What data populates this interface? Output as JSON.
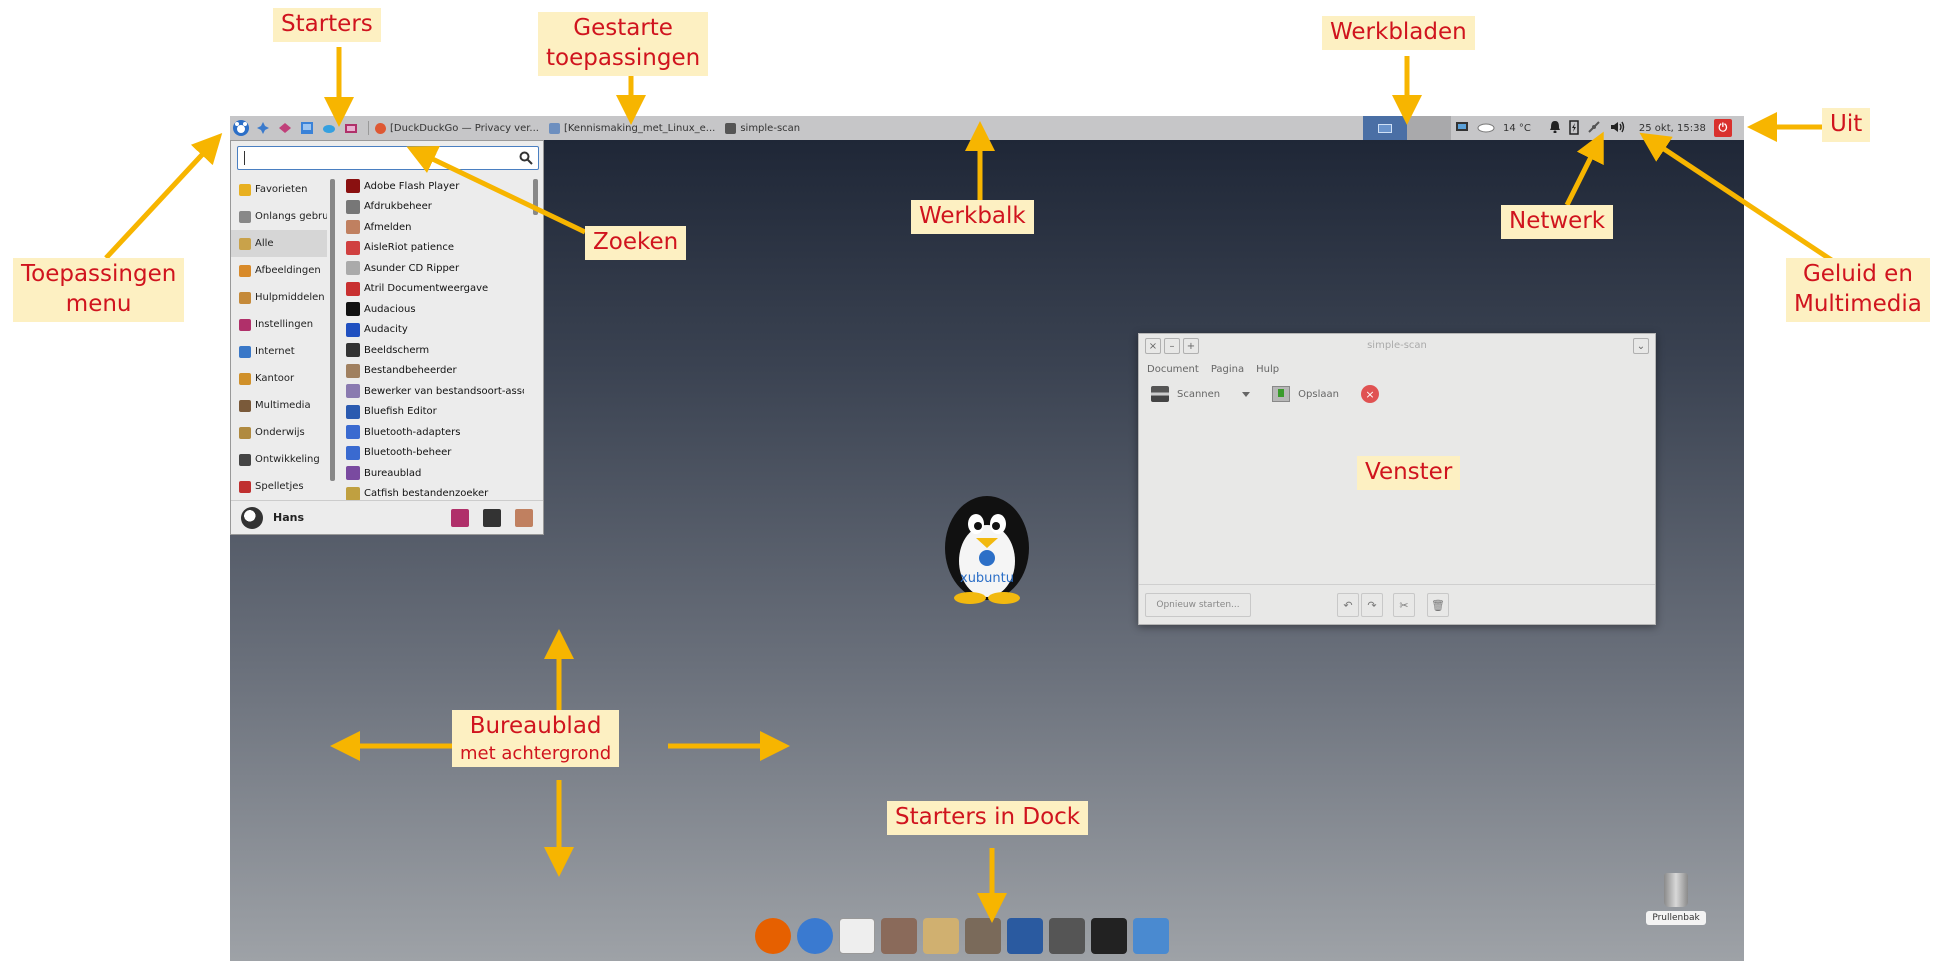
{
  "annotations": {
    "starters": "Starters",
    "gestarte_line1": "Gestarte",
    "gestarte_line2": "toepassingen",
    "werkbladen": "Werkbladen",
    "uit": "Uit",
    "werkbalk": "Werkbalk",
    "netwerk": "Netwerk",
    "toepassingen_line1": "Toepassingen",
    "toepassingen_line2": "menu",
    "zoeken": "Zoeken",
    "geluid_line1": "Geluid en",
    "geluid_line2": "Multimedia",
    "venster": "Venster",
    "bureaublad_line1": "Bureaublad",
    "bureaublad_line2": "met achtergrond",
    "dock": "Starters in Dock"
  },
  "panel": {
    "tasks": [
      {
        "label": "[DuckDuckGo — Privacy ver...",
        "color": "#de5833"
      },
      {
        "label": "[Kennismaking_met_Linux_e...",
        "color": "#6d8fbf"
      },
      {
        "label": "simple-scan",
        "color": "#555555"
      }
    ],
    "weather": "14 °C",
    "clock": "25 okt, 15:38"
  },
  "menu": {
    "categories": [
      {
        "label": "Favorieten",
        "color": "#e8b020"
      },
      {
        "label": "Onlangs gebruikt",
        "color": "#888888"
      },
      {
        "label": "Alle",
        "color": "#c9a24a"
      },
      {
        "label": "Afbeeldingen",
        "color": "#d88a2a"
      },
      {
        "label": "Hulpmiddelen",
        "color": "#c58a3a"
      },
      {
        "label": "Instellingen",
        "color": "#b0306a"
      },
      {
        "label": "Internet",
        "color": "#3a78c8"
      },
      {
        "label": "Kantoor",
        "color": "#d0902a"
      },
      {
        "label": "Multimedia",
        "color": "#7a5a3a"
      },
      {
        "label": "Onderwijs",
        "color": "#b08a40"
      },
      {
        "label": "Ontwikkeling",
        "color": "#444444"
      },
      {
        "label": "Spelletjes",
        "color": "#c03030"
      }
    ],
    "apps": [
      {
        "label": "Adobe Flash Player",
        "color": "#8a1010"
      },
      {
        "label": "Afdrukbeheer",
        "color": "#777777"
      },
      {
        "label": "Afmelden",
        "color": "#c08060"
      },
      {
        "label": "AisleRiot patience",
        "color": "#d04040"
      },
      {
        "label": "Asunder CD Ripper",
        "color": "#aaaaaa"
      },
      {
        "label": "Atril Documentweergave",
        "color": "#c83030"
      },
      {
        "label": "Audacious",
        "color": "#111111"
      },
      {
        "label": "Audacity",
        "color": "#2050c0"
      },
      {
        "label": "Beeldscherm",
        "color": "#333333"
      },
      {
        "label": "Bestandbeheerder",
        "color": "#a08060"
      },
      {
        "label": "Bewerker van bestandsoort-associ...",
        "color": "#8a7ab0"
      },
      {
        "label": "Bluefish Editor",
        "color": "#2a5ab0"
      },
      {
        "label": "Bluetooth-adapters",
        "color": "#3a6ad0"
      },
      {
        "label": "Bluetooth-beheer",
        "color": "#3a6ad0"
      },
      {
        "label": "Bureaublad",
        "color": "#7a4aa0"
      },
      {
        "label": "Catfish bestandenzoeker",
        "color": "#c0a040"
      }
    ],
    "user": "Hans"
  },
  "window": {
    "title": "simple-scan",
    "menus": [
      "Document",
      "Pagina",
      "Hulp"
    ],
    "scan_label": "Scannen",
    "save_label": "Opslaan",
    "restart_label": "Opnieuw starten..."
  },
  "desktop": {
    "trash_label": "Prullenbak",
    "penguin_text": "xubuntu"
  },
  "dock": [
    {
      "name": "firefox-icon",
      "color": "#e66000"
    },
    {
      "name": "thunderbird-icon",
      "color": "#3a7ad0"
    },
    {
      "name": "document-icon",
      "color": "#eeeeee"
    },
    {
      "name": "printer-icon",
      "color": "#8a6a5a"
    },
    {
      "name": "photos-icon",
      "color": "#d0b070"
    },
    {
      "name": "gimp-icon",
      "color": "#7a6a5a"
    },
    {
      "name": "fish-icon",
      "color": "#2a5aa0"
    },
    {
      "name": "scanner-icon",
      "color": "#555555"
    },
    {
      "name": "terminal-icon",
      "color": "#222222"
    },
    {
      "name": "screenshot-icon",
      "color": "#4a8ad0"
    }
  ]
}
